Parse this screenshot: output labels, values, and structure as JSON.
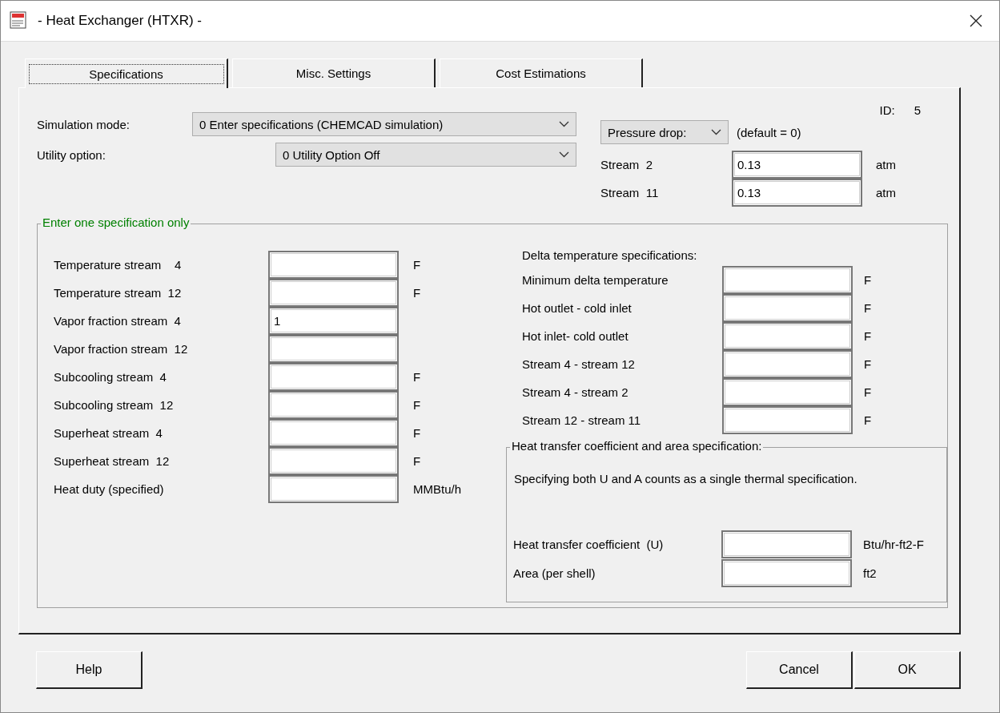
{
  "window": {
    "title": "- Heat Exchanger (HTXR) -"
  },
  "tabs": [
    {
      "label": "Specifications",
      "selected": true
    },
    {
      "label": "Misc. Settings",
      "selected": false
    },
    {
      "label": "Cost Estimations",
      "selected": false
    }
  ],
  "id": {
    "label": "ID:",
    "value": "5"
  },
  "simulation_mode": {
    "label": "Simulation mode:",
    "value": "0 Enter specifications (CHEMCAD simulation)"
  },
  "utility_option": {
    "label": "Utility option:",
    "value": "0 Utility Option Off"
  },
  "pressure_drop": {
    "selector": "Pressure drop:",
    "note": "(default = 0)",
    "rows": [
      {
        "label": "Stream  2",
        "value": "0.13",
        "unit": "atm"
      },
      {
        "label": "Stream  11",
        "value": "0.13",
        "unit": "atm"
      }
    ]
  },
  "specification_group": {
    "title": "Enter one specification only",
    "rows": [
      {
        "label": "Temperature stream    4",
        "unit": "F"
      },
      {
        "label": "Temperature stream  12",
        "unit": "F"
      },
      {
        "label": "Vapor fraction stream  4",
        "value": "1"
      },
      {
        "label": "Vapor fraction stream  12"
      },
      {
        "label": "Subcooling stream  4",
        "unit": "F"
      },
      {
        "label": "Subcooling stream  12",
        "unit": "F"
      },
      {
        "label": "Superheat stream  4",
        "unit": "F"
      },
      {
        "label": "Superheat stream  12",
        "unit": "F"
      },
      {
        "label": "Heat duty (specified)",
        "unit": "MMBtu/h"
      }
    ],
    "delta": {
      "title": "Delta temperature specifications:",
      "rows": [
        {
          "label": "Minimum delta temperature",
          "unit": "F"
        },
        {
          "label": "Hot outlet - cold inlet",
          "unit": "F"
        },
        {
          "label": "Hot inlet- cold outlet",
          "unit": "F"
        },
        {
          "label": "Stream 4 - stream 12",
          "unit": "F"
        },
        {
          "label": "Stream 4 - stream 2",
          "unit": "F"
        },
        {
          "label": "Stream 12 - stream 11",
          "unit": "F"
        }
      ]
    },
    "heat_transfer": {
      "title": "Heat transfer coefficient and area specification:",
      "note": "Specifying both U and A counts as a single thermal specification.",
      "rows": [
        {
          "label": "Heat transfer coefficient  (U)",
          "unit": "Btu/hr-ft2-F"
        },
        {
          "label": "Area (per shell)",
          "unit": "ft2"
        }
      ]
    }
  },
  "left_buttons": [
    {
      "label": "Help"
    }
  ],
  "right_buttons": [
    {
      "label": "Cancel"
    },
    {
      "label": "OK"
    }
  ]
}
